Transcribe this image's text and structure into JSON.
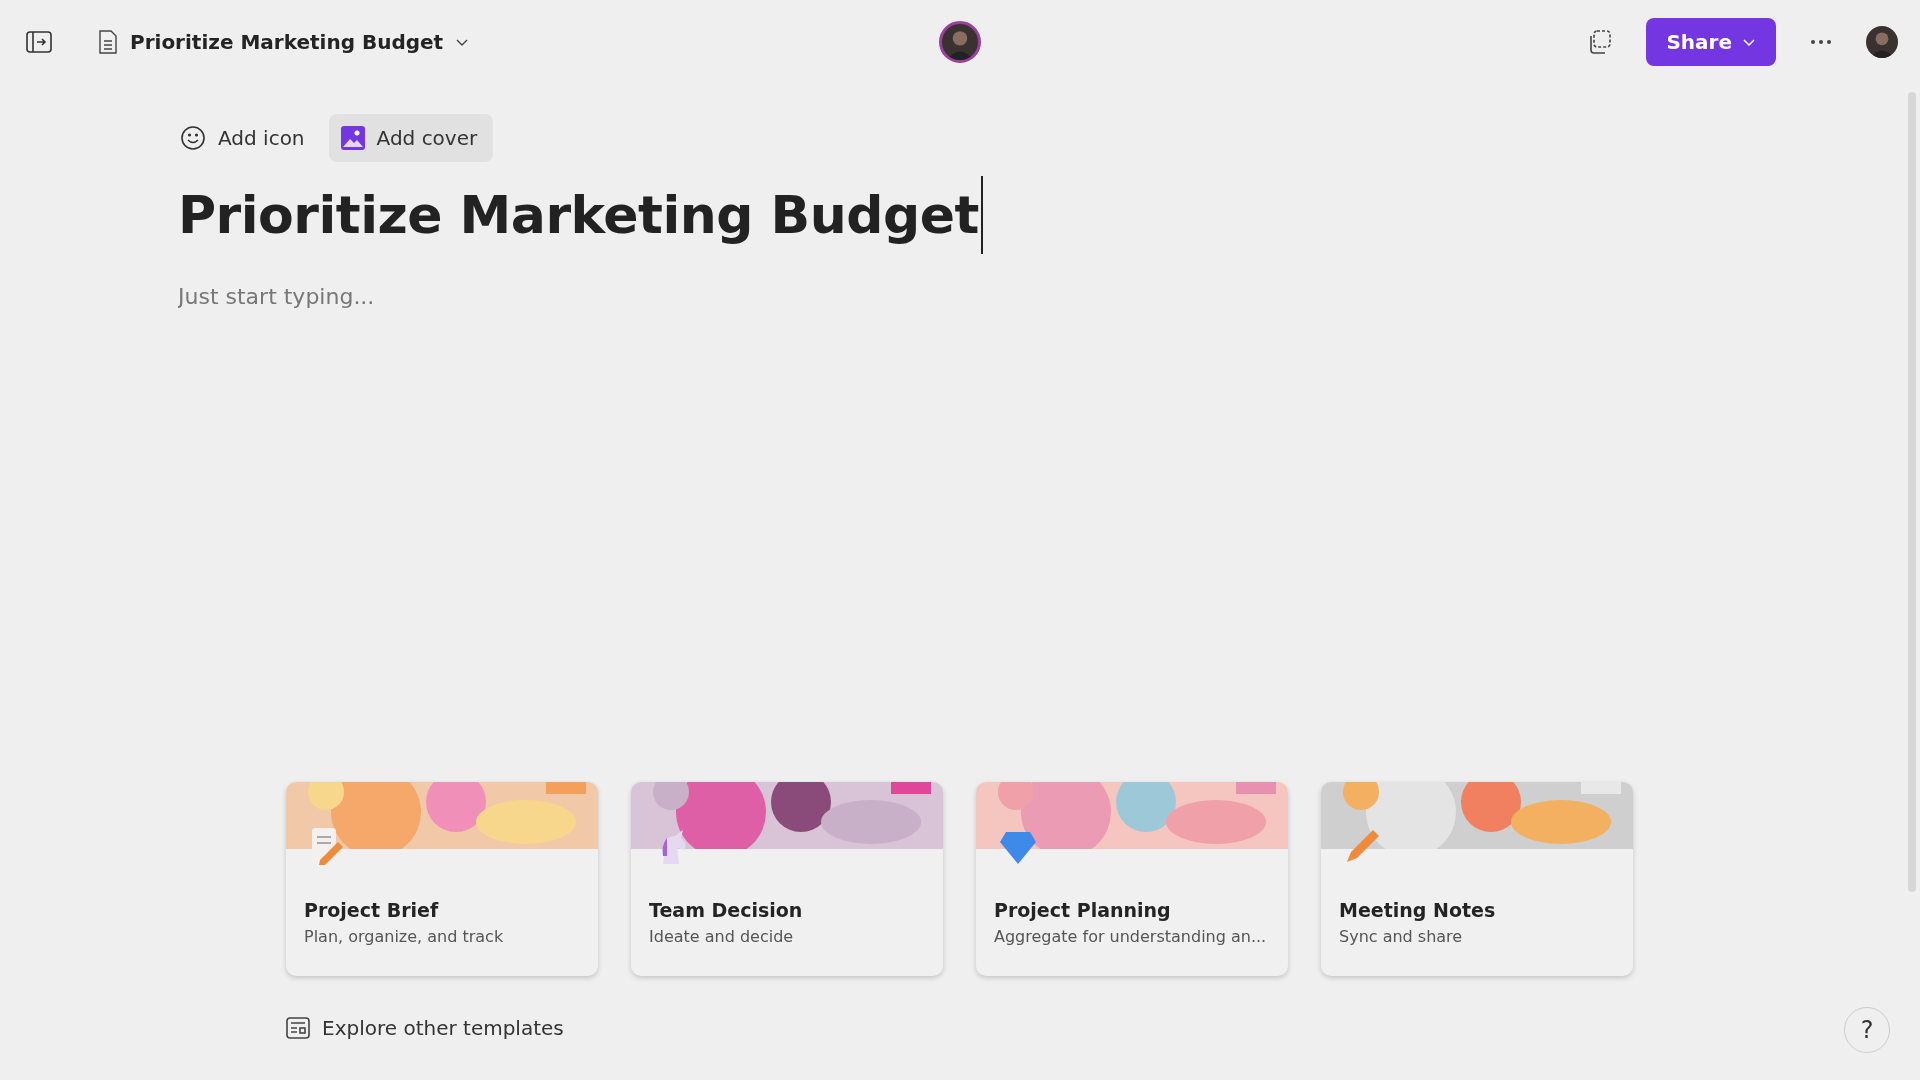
{
  "header": {
    "document_title": "Prioritize Marketing Budget",
    "share_label": "Share"
  },
  "page_actions": [
    {
      "kind": "icon",
      "label": "Add icon",
      "hovered": false
    },
    {
      "kind": "cover",
      "label": "Add cover",
      "hovered": true
    }
  ],
  "page": {
    "title": "Prioritize Marketing Budget",
    "placeholder": "Just start typing..."
  },
  "templates": [
    {
      "kind": "brief",
      "title": "Project Brief",
      "description": "Plan, organize, and track"
    },
    {
      "kind": "decision",
      "title": "Team Decision",
      "description": "Ideate and decide"
    },
    {
      "kind": "planning",
      "title": "Project Planning",
      "description": "Aggregate for understanding an..."
    },
    {
      "kind": "notes",
      "title": "Meeting Notes",
      "description": "Sync and share"
    }
  ],
  "explore_label": "Explore other templates",
  "help_label": "?"
}
